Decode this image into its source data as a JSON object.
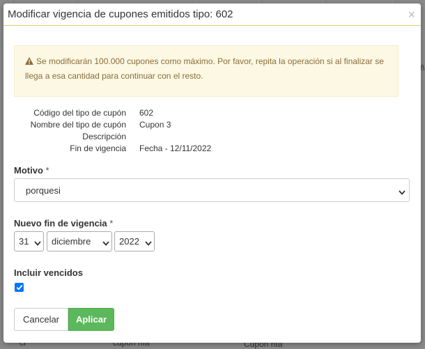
{
  "modal": {
    "title": "Modificar vigencia de cupones emitidos tipo: 602",
    "close": "×"
  },
  "alert": {
    "icon": "warning-icon",
    "text": "Se modificarán 100.000 cupones como máximo. Por favor, repita la operación si al finalizar se llega a esa cantidad para continuar con el resto."
  },
  "info": {
    "rows": [
      {
        "label": "Código del tipo de cupón",
        "value": "602"
      },
      {
        "label": "Nombre del tipo de cupón",
        "value": "Cupon 3"
      },
      {
        "label": "Descripción",
        "value": ""
      },
      {
        "label": "Fin de vigencia",
        "value": "Fecha - 12/11/2022"
      }
    ]
  },
  "motivo": {
    "label": "Motivo",
    "required": "*",
    "value": "porquesi"
  },
  "nuevo_fin": {
    "label": "Nuevo fin de vigencia",
    "required": "*",
    "day": "31",
    "month": "diciembre",
    "year": "2022"
  },
  "incluir": {
    "label": "Incluir vencidos",
    "checked": true
  },
  "buttons": {
    "cancel": "Cancelar",
    "apply": "Aplicar"
  },
  "background": {
    "right_fragment": "ña",
    "bottom_left": "cr",
    "bottom_mid": "cupon rifa",
    "bottom_right": "Cupon rifa"
  },
  "colors": {
    "accent": "#e6c86a",
    "alert_bg": "#fcf8e3",
    "alert_text": "#8a6d3b",
    "apply_bg": "#5cb85c",
    "checkbox": "#0075ff"
  }
}
